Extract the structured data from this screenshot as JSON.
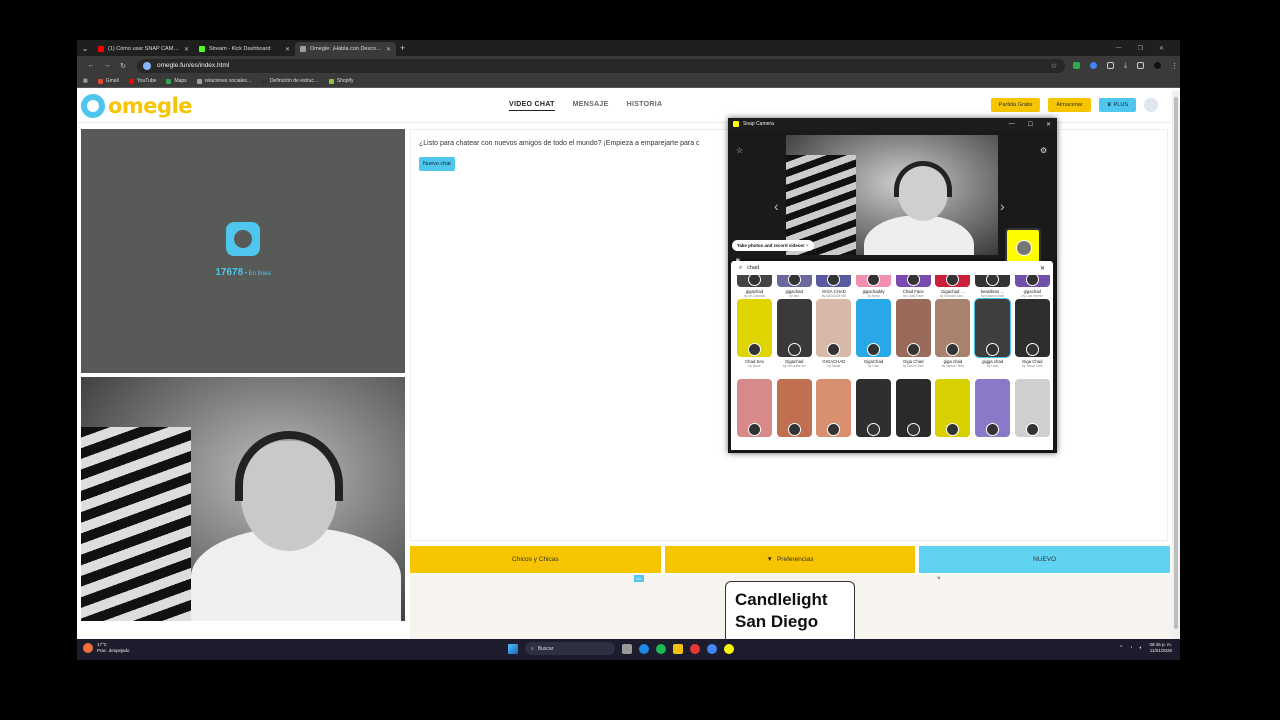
{
  "browser": {
    "tabs": [
      {
        "title": "(1) Cómo usar SNAP CAMERA",
        "color": "#ff0000",
        "active": false
      },
      {
        "title": "Stream - Kick Dashboard",
        "color": "#53fc18",
        "active": false
      },
      {
        "title": "Omegle: ¡Habla con Desco…",
        "color": "#9aa0a6",
        "active": true
      }
    ],
    "url": "omegle.fun/es/index.html",
    "bookmarks": [
      {
        "label": "Gmail",
        "color": "#ea4335"
      },
      {
        "label": "YouTube",
        "color": "#ff0000"
      },
      {
        "label": "Maps",
        "color": "#34a853"
      },
      {
        "label": "relaciones sociales…",
        "color": "#9aa0a6"
      },
      {
        "label": "Definición de estruc…",
        "color": "#333333"
      },
      {
        "label": "Shopify",
        "color": "#95bf47"
      }
    ]
  },
  "site": {
    "logo_text": "omegle",
    "nav": [
      "VIDEO CHAT",
      "MENSAJE",
      "HISTORIA"
    ],
    "header_buttons": {
      "free": "Partida Gratis",
      "store": "Almacenar",
      "plus": "PLUS"
    },
    "online_count": "17678",
    "online_label": "• En línea",
    "chat_prompt": "¿Listo para chatear con nuevos amigos de todo el mundo? ¡Empieza a emparejarte para c",
    "new_chat": "Nuevo chat",
    "actions": {
      "gender": "Chicos y Chicas",
      "prefs": "Preferencias",
      "next": "NUEVO"
    },
    "ad": {
      "badge": "AD",
      "close": "×",
      "line1": "Candlelight",
      "line2": "San Diego"
    }
  },
  "snap_camera": {
    "title": "Snap Camera",
    "tip": "Take photos and record videos!",
    "search_query": "chad",
    "rows": [
      [
        {
          "name": "gigachad",
          "by": "by Mr.Cardinal",
          "bg": "#444444"
        },
        {
          "name": "gigachad",
          "by": "by tanl",
          "bg": "#6a6a9a"
        },
        {
          "name": "GIGA CHAD",
          "by": "by SADDAM ME",
          "bg": "#5a5aa0"
        },
        {
          "name": "gigachaddy",
          "by": "by Ninty",
          "bg": "#f28fae"
        },
        {
          "name": "Chad Face",
          "by": "by Chad Face",
          "bg": "#7a4ab0"
        },
        {
          "name": "Gigachad …",
          "by": "by Edward Jarv…",
          "bg": "#c8203a"
        },
        {
          "name": "beardless …",
          "by": "by poland kinds",
          "bg": "#333333"
        },
        {
          "name": "gigachad",
          "by": "by Luci Herrez",
          "bg": "#7050a8"
        }
      ],
      [
        {
          "name": "Chad Sex",
          "by": "by Nose",
          "bg": "#e0d400"
        },
        {
          "name": "Gigachad",
          "by": "by min edits len",
          "bg": "#3a3a3a"
        },
        {
          "name": "GIGACHAD",
          "by": "by Nikas",
          "bg": "#d8b8a8"
        },
        {
          "name": "GigaChad",
          "by": "by Holu",
          "bg": "#29a8e8"
        },
        {
          "name": "Giga Chad",
          "by": "by David Glick",
          "bg": "#9a6a5a"
        },
        {
          "name": "giga chad",
          "by": "by Nelson Tech",
          "bg": "#a8826c"
        },
        {
          "name": "gigga chad",
          "by": "by Lace",
          "bg": "#3e3e3e"
        },
        {
          "name": "Giga Chad",
          "by": "by Jacob Cole",
          "bg": "#2e2e2e"
        }
      ],
      [
        {
          "name": "",
          "by": "",
          "bg": "#d88a8a"
        },
        {
          "name": "",
          "by": "",
          "bg": "#c07050"
        },
        {
          "name": "",
          "by": "",
          "bg": "#d89070"
        },
        {
          "name": "",
          "by": "",
          "bg": "#2f2f2f"
        },
        {
          "name": "",
          "by": "",
          "bg": "#2a2a2a"
        },
        {
          "name": "",
          "by": "",
          "bg": "#d8d000"
        },
        {
          "name": "",
          "by": "",
          "bg": "#8a78c8"
        },
        {
          "name": "",
          "by": "",
          "bg": "#cfcfcf"
        }
      ]
    ]
  },
  "taskbar": {
    "weather_temp": "17°C",
    "weather_desc": "Prac. despejado",
    "search_label": "Buscar",
    "time": "08:45 p. m.",
    "date": "11/01/2026"
  }
}
